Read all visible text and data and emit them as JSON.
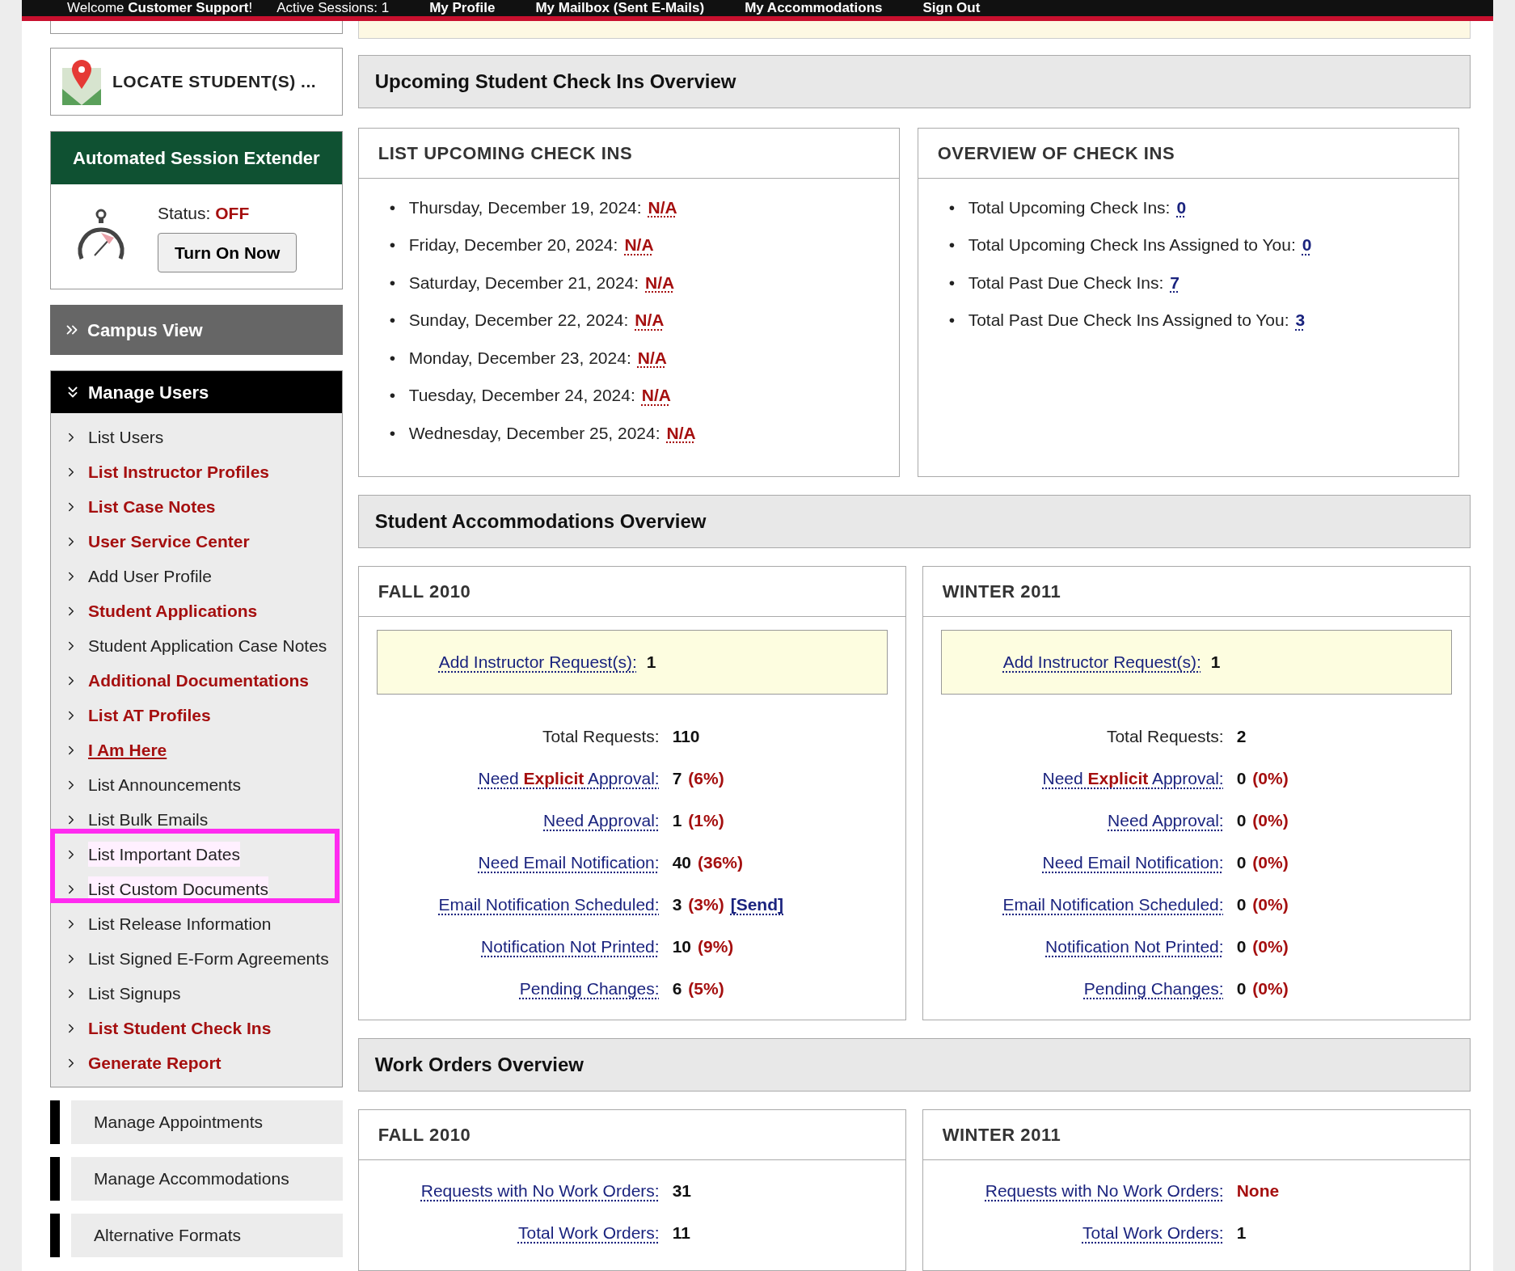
{
  "top_bar": {
    "welcome": "Welcome **Customer Support**!",
    "sessions": "Active Sessions: 1",
    "links": [
      "My Profile",
      "My Mailbox (Sent E-Mails)",
      "My Accommodations",
      "Sign Out"
    ]
  },
  "sidebar": {
    "locate_button": "LOCATE STUDENT(S) ...",
    "session_extender": {
      "title": "Automated Session Extender",
      "status_label": "Status:",
      "status": "OFF",
      "on": false,
      "button": "Turn On Now"
    },
    "campus_view": {
      "label": "Campus View",
      "expanded": false
    },
    "manage_users": {
      "label": "Manage Users",
      "expanded": true,
      "items": [
        {
          "label": "List Users",
          "kind": "plain",
          "highlighted": false
        },
        {
          "label": "List Instructor Profiles",
          "kind": "featured",
          "highlighted": false
        },
        {
          "label": "List Case Notes",
          "kind": "featured",
          "highlighted": false
        },
        {
          "label": "User Service Center",
          "kind": "featured",
          "highlighted": false
        },
        {
          "label": "Add User Profile",
          "kind": "plain",
          "highlighted": false
        },
        {
          "label": "Student Applications",
          "kind": "featured",
          "highlighted": false
        },
        {
          "label": "Student Application Case Notes",
          "kind": "plain",
          "highlighted": false
        },
        {
          "label": "Additional Documentations",
          "kind": "featured",
          "highlighted": false
        },
        {
          "label": "List AT Profiles",
          "kind": "featured",
          "highlighted": false
        },
        {
          "label": "I Am Here",
          "kind": "current",
          "highlighted": false
        },
        {
          "label": "List Announcements",
          "kind": "plain",
          "highlighted": false
        },
        {
          "label": "List Bulk Emails",
          "kind": "plain",
          "highlighted": false
        },
        {
          "label": "List Important Dates",
          "kind": "plain",
          "highlighted": true
        },
        {
          "label": "List Custom Documents",
          "kind": "plain",
          "highlighted": true
        },
        {
          "label": "List Release Information",
          "kind": "plain",
          "highlighted": false
        },
        {
          "label": "List Signed E-Form Agreements",
          "kind": "plain",
          "highlighted": false
        },
        {
          "label": "List Signups",
          "kind": "plain",
          "highlighted": false
        },
        {
          "label": "List Student Check Ins",
          "kind": "featured",
          "highlighted": false
        },
        {
          "label": "Generate Report",
          "kind": "featured",
          "highlighted": false
        }
      ]
    },
    "sections": [
      "Manage Appointments",
      "Manage Accommodations",
      "Alternative Formats"
    ]
  },
  "check_ins": {
    "title": "Upcoming Student Check Ins Overview",
    "list": {
      "title": "LIST UPCOMING CHECK INS",
      "items": [
        {
          "bullet": "•",
          "label": "Thursday, December 19, 2024:",
          "value": "N/A"
        },
        {
          "bullet": "•",
          "label": "Friday, December 20, 2024:",
          "value": "N/A"
        },
        {
          "bullet": "•",
          "label": "Saturday, December 21, 2024:",
          "value": "N/A"
        },
        {
          "bullet": "•",
          "label": "Sunday, December 22, 2024:",
          "value": "N/A"
        },
        {
          "bullet": "•",
          "label": "Monday, December 23, 2024:",
          "value": "N/A"
        },
        {
          "bullet": "•",
          "label": "Tuesday, December 24, 2024:",
          "value": "N/A"
        },
        {
          "bullet": "•",
          "label": "Wednesday, December 25, 2024:",
          "value": "N/A"
        }
      ]
    },
    "overview": {
      "title": "OVERVIEW OF CHECK INS",
      "items": [
        {
          "bullet": "•",
          "label": "Total Upcoming Check Ins:",
          "value": "0"
        },
        {
          "bullet": "•",
          "label": "Total Upcoming Check Ins Assigned to You:",
          "value": "0"
        },
        {
          "bullet": "•",
          "label": "Total Past Due Check Ins:",
          "value": "7"
        },
        {
          "bullet": "•",
          "label": "Total Past Due Check Ins Assigned to You:",
          "value": "3"
        }
      ]
    }
  },
  "accommodations": {
    "title": "Student Accommodations Overview",
    "terms": [
      {
        "title": "FALL 2010",
        "instructor_request": {
          "label": "Add Instructor Request(s):",
          "value": "1"
        },
        "rows": [
          {
            "kind": "total",
            "label": "Total Requests:",
            "count": "110"
          },
          {
            "kind": "link",
            "label": "Need **Explicit** Approval:",
            "count": "7",
            "percent": "(6%)"
          },
          {
            "kind": "link",
            "label": "Need Approval:",
            "count": "1",
            "percent": "(1%)"
          },
          {
            "kind": "link",
            "label": "Need Email Notification:",
            "count": "40",
            "percent": "(36%)"
          },
          {
            "kind": "link",
            "label": "Email Notification Scheduled:",
            "count": "3",
            "percent": "(3%)",
            "action": "[Send]"
          },
          {
            "kind": "link",
            "label": "Notification Not Printed:",
            "count": "10",
            "percent": "(9%)"
          },
          {
            "kind": "link",
            "label": "Pending Changes:",
            "count": "6",
            "percent": "(5%)"
          }
        ]
      },
      {
        "title": "WINTER 2011",
        "instructor_request": {
          "label": "Add Instructor Request(s):",
          "value": "1"
        },
        "rows": [
          {
            "kind": "total",
            "label": "Total Requests:",
            "count": "2"
          },
          {
            "kind": "link",
            "label": "Need **Explicit** Approval:",
            "count": "0",
            "percent": "(0%)"
          },
          {
            "kind": "link",
            "label": "Need Approval:",
            "count": "0",
            "percent": "(0%)"
          },
          {
            "kind": "link",
            "label": "Need Email Notification:",
            "count": "0",
            "percent": "(0%)"
          },
          {
            "kind": "link",
            "label": "Email Notification Scheduled:",
            "count": "0",
            "percent": "(0%)"
          },
          {
            "kind": "link",
            "label": "Notification Not Printed:",
            "count": "0",
            "percent": "(0%)"
          },
          {
            "kind": "link",
            "label": "Pending Changes:",
            "count": "0",
            "percent": "(0%)"
          }
        ]
      }
    ]
  },
  "work_orders": {
    "title": "Work Orders Overview",
    "terms": [
      {
        "title": "FALL 2010",
        "rows": [
          {
            "label": "Requests with No Work Orders:",
            "value": "31",
            "alert": false
          },
          {
            "label": "Total Work Orders:",
            "value": "11",
            "alert": false
          }
        ]
      },
      {
        "title": "WINTER 2011",
        "rows": [
          {
            "label": "Requests with No Work Orders:",
            "value": "None",
            "alert": true
          },
          {
            "label": "Total Work Orders:",
            "value": "1",
            "alert": false
          }
        ]
      }
    ]
  }
}
